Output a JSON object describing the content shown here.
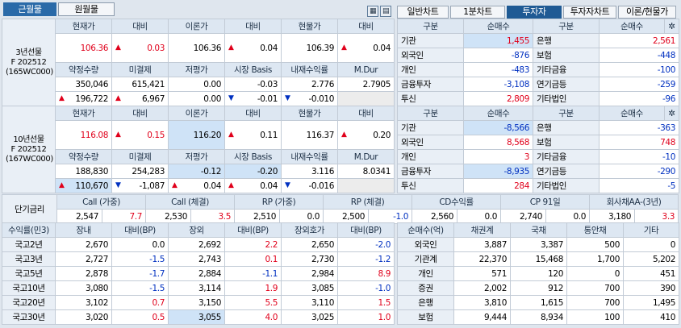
{
  "top": {
    "btn_near": "근월물",
    "btn_far": "원월물"
  },
  "tabs": [
    "일반차트",
    "1분차트",
    "투자자",
    "투자자차트",
    "이론/현물가"
  ],
  "icons": {
    "grid": "grid-icon",
    "list": "list-icon",
    "gear": "gear-icon"
  },
  "f3": {
    "label": [
      "3년선물",
      "F 202512",
      "(165WC000)"
    ],
    "h1": [
      "현재가",
      "대비",
      "이론가",
      "대비",
      "현물가",
      "대비"
    ],
    "r1": {
      "cur": "106.36",
      "d1": "0.03",
      "theory": "106.36",
      "d2": "0.04",
      "spot": "106.39",
      "d3": "0.04"
    },
    "h2": [
      "약정수량",
      "미결제",
      "저평가",
      "시장 Basis",
      "내재수익률",
      "M.Dur"
    ],
    "r2": [
      "350,046",
      "615,421",
      "0.00",
      "-0.03",
      "2.776",
      "2.7905"
    ],
    "r3": {
      "vol": "196,722",
      "oi": "6,967",
      "under": "0.00",
      "basis": "-0.01",
      "irr": "-0.010"
    }
  },
  "f10": {
    "label": [
      "10년선물",
      "F 202512",
      "(167WC000)"
    ],
    "h1": [
      "현재가",
      "대비",
      "이론가",
      "대비",
      "현물가",
      "대비"
    ],
    "r1": {
      "cur": "116.08",
      "d1": "0.15",
      "theory": "116.20",
      "d2": "0.11",
      "spot": "116.37",
      "d3": "0.20"
    },
    "h2": [
      "약정수량",
      "미결제",
      "저평가",
      "시장 Basis",
      "내재수익률",
      "M.Dur"
    ],
    "r2": [
      "188,830",
      "254,283",
      "-0.12",
      "-0.20",
      "3.116",
      "8.0341"
    ],
    "r3": {
      "vol": "110,670",
      "oi": "-1,087",
      "under": "0.04",
      "basis": "0.04",
      "irr": "-0.016"
    }
  },
  "inv1": {
    "h": [
      "구분",
      "순매수",
      "구분",
      "순매수"
    ],
    "rows": [
      [
        "기관",
        "1,455",
        "은행",
        "2,561"
      ],
      [
        "외국인",
        "-876",
        "보험",
        "-448"
      ],
      [
        "개인",
        "-483",
        "기타금융",
        "-100"
      ],
      [
        "금융투자",
        "-3,108",
        "연기금등",
        "-259"
      ],
      [
        "투신",
        "2,809",
        "기타법인",
        "-96"
      ]
    ]
  },
  "inv2": {
    "h": [
      "구분",
      "순매수",
      "구분",
      "순매수"
    ],
    "rows": [
      [
        "기관",
        "-8,566",
        "은행",
        "-363"
      ],
      [
        "외국인",
        "8,568",
        "보험",
        "748"
      ],
      [
        "개인",
        "3",
        "기타금융",
        "-10"
      ],
      [
        "금융투자",
        "-8,935",
        "연기금등",
        "-290"
      ],
      [
        "투신",
        "284",
        "기타법인",
        "-5"
      ]
    ]
  },
  "short": {
    "title": "단기금리",
    "h": [
      "Call (가중)",
      "Call (체결)",
      "RP (가중)",
      "RP (체결)",
      "CD수익률",
      "CP 91일",
      "회사채AA-(3년)"
    ],
    "v": [
      [
        "2,547",
        "7.7"
      ],
      [
        "2,530",
        "3.5"
      ],
      [
        "2,510",
        "0.0"
      ],
      [
        "2,500",
        "-1.0"
      ],
      [
        "2,560",
        "0.0"
      ],
      [
        "2,740",
        "0.0"
      ],
      [
        "3,180",
        "3.3"
      ]
    ]
  },
  "yield": {
    "h": [
      "수익률(민3)",
      "장내",
      "대비(BP)",
      "장외",
      "대비(BP)",
      "장외호가",
      "대비(BP)"
    ],
    "rows": [
      [
        "국고2년",
        "2,670",
        "0.0",
        "2,692",
        "2.2",
        "2,650",
        "-2.0"
      ],
      [
        "국고3년",
        "2,727",
        "-1.5",
        "2,743",
        "0.1",
        "2,730",
        "-1.2"
      ],
      [
        "국고5년",
        "2,878",
        "-1.7",
        "2,884",
        "-1.1",
        "2,984",
        "8.9"
      ],
      [
        "국고10년",
        "3,080",
        "-1.5",
        "3,114",
        "1.9",
        "3,085",
        "-1.0"
      ],
      [
        "국고20년",
        "3,102",
        "0.7",
        "3,150",
        "5.5",
        "3,110",
        "1.5"
      ],
      [
        "국고30년",
        "3,020",
        "0.5",
        "3,055",
        "4.0",
        "3,025",
        "1.0"
      ]
    ]
  },
  "netbuy": {
    "h": [
      "순매수(억)",
      "채권계",
      "국채",
      "통안채",
      "기타"
    ],
    "rows": [
      [
        "외국인",
        "3,887",
        "3,387",
        "500",
        "0"
      ],
      [
        "기관계",
        "22,370",
        "15,468",
        "1,700",
        "5,202"
      ],
      [
        "개인",
        "571",
        "120",
        "0",
        "451"
      ],
      [
        "증권",
        "2,002",
        "912",
        "700",
        "390"
      ],
      [
        "은행",
        "3,810",
        "1,615",
        "700",
        "1,495"
      ],
      [
        "보험",
        "9,444",
        "8,934",
        "100",
        "410"
      ]
    ]
  }
}
